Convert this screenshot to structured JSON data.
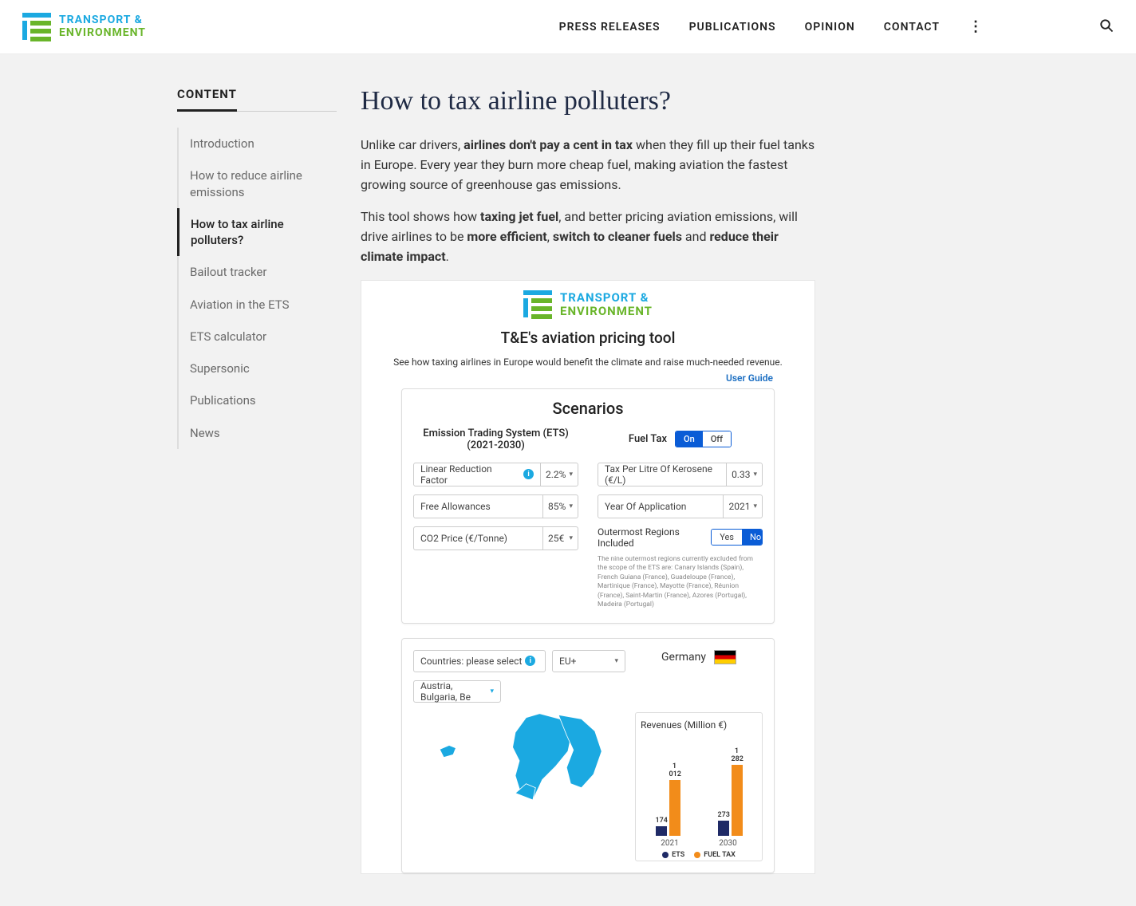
{
  "header": {
    "logo_line1": "TRANSPORT &",
    "logo_line2": "ENVIRONMENT",
    "nav": {
      "press": "PRESS RELEASES",
      "pubs": "PUBLICATIONS",
      "opinion": "OPINION",
      "contact": "CONTACT"
    }
  },
  "sidebar": {
    "title": "CONTENT",
    "items": [
      "Introduction",
      "How to reduce airline emissions",
      "How to tax airline polluters?",
      "Bailout tracker",
      "Aviation in the ETS",
      "ETS calculator",
      "Supersonic",
      "Publications",
      "News"
    ],
    "active_index": 2
  },
  "article": {
    "title": "How to tax airline polluters?",
    "p1_a": "Unlike car drivers, ",
    "p1_b": "airlines don't pay a cent in tax",
    "p1_c": " when they fill up their fuel tanks in Europe. Every year they burn more cheap fuel, making aviation the fastest growing source of greenhouse gas emissions.",
    "p2_a": "This tool shows how ",
    "p2_b": "taxing jet fuel",
    "p2_c": ", and better pricing aviation emissions, will drive airlines to be ",
    "p2_d": "more efficient",
    "p2_e": ", ",
    "p2_f": "switch to cleaner fuels",
    "p2_g": " and ",
    "p2_h": "reduce their climate impact",
    "p2_i": "."
  },
  "tool": {
    "title": "T&E's aviation pricing tool",
    "sub": "See how taxing airlines in Europe would benefit the climate and raise much-needed revenue.",
    "guide": "User Guide",
    "scenarios": "Scenarios",
    "ets_head": "Emission Trading System (ETS) (2021-2030)",
    "fuel_head": "Fuel Tax",
    "on": "On",
    "off": "Off",
    "fields": {
      "lrf": "Linear Reduction Factor",
      "lrf_v": "2.2%",
      "free": "Free Allowances",
      "free_v": "85%",
      "co2": "CO2 Price (€/Tonne)",
      "co2_v": "25€",
      "tax": "Tax Per Litre Of Kerosene (€/L)",
      "tax_v": "0.33",
      "year": "Year Of Application",
      "year_v": "2021"
    },
    "outer_label": "Outermost Regions Included",
    "yes": "Yes",
    "no": "No",
    "note": "The nine outermost regions currently excluded from the scope of the ETS are: Canary Islands (Spain), French Guiana (France), Guadeloupe (France), Martinique (France), Mayotte (France), Réunion (France), Saint-Martin (France), Azores (Portugal), Madeira (Portugal)",
    "countries_label": "Countries: please select",
    "countries_scope": "EU+",
    "countries_sel": "Austria, Bulgaria, Be",
    "country": "Germany",
    "chart_title": "Revenues (Million €)",
    "legend_ets": "ETS",
    "legend_fuel": "FUEL TAX"
  },
  "chart_data": {
    "type": "bar",
    "title": "Revenues (Million €)",
    "categories": [
      "2021",
      "2030"
    ],
    "series": [
      {
        "name": "ETS",
        "values": [
          174,
          273
        ],
        "color": "#1f2a66"
      },
      {
        "name": "FUEL TAX",
        "values": [
          1012,
          1282
        ],
        "color": "#f28c1a"
      }
    ],
    "ylim": [
      0,
      1300
    ]
  }
}
